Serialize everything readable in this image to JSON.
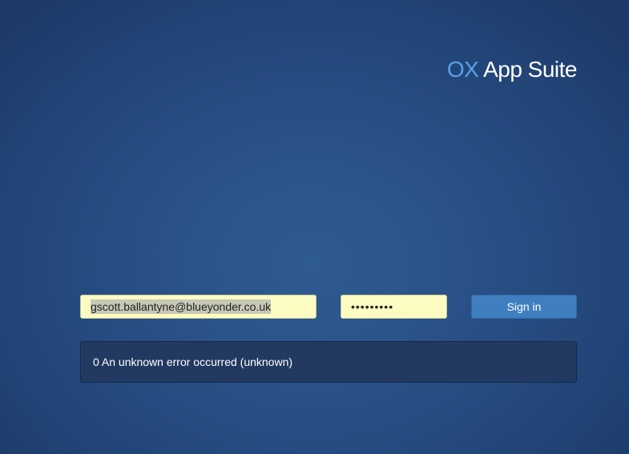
{
  "branding": {
    "logo_prefix": "OX",
    "logo_suffix": " App Suite"
  },
  "login": {
    "username_value": "gscott.ballantyne@blueyonder.co.uk",
    "password_mask": "•••••••••",
    "signin_label": "Sign in"
  },
  "alert": {
    "message": "0 An unknown error occurred (unknown)"
  },
  "colors": {
    "background": "#2a5288",
    "logo_accent": "#5aa2e6",
    "input_background": "#fbfbc2",
    "button": "#3f7ebf",
    "alert_background": "#223a61"
  }
}
